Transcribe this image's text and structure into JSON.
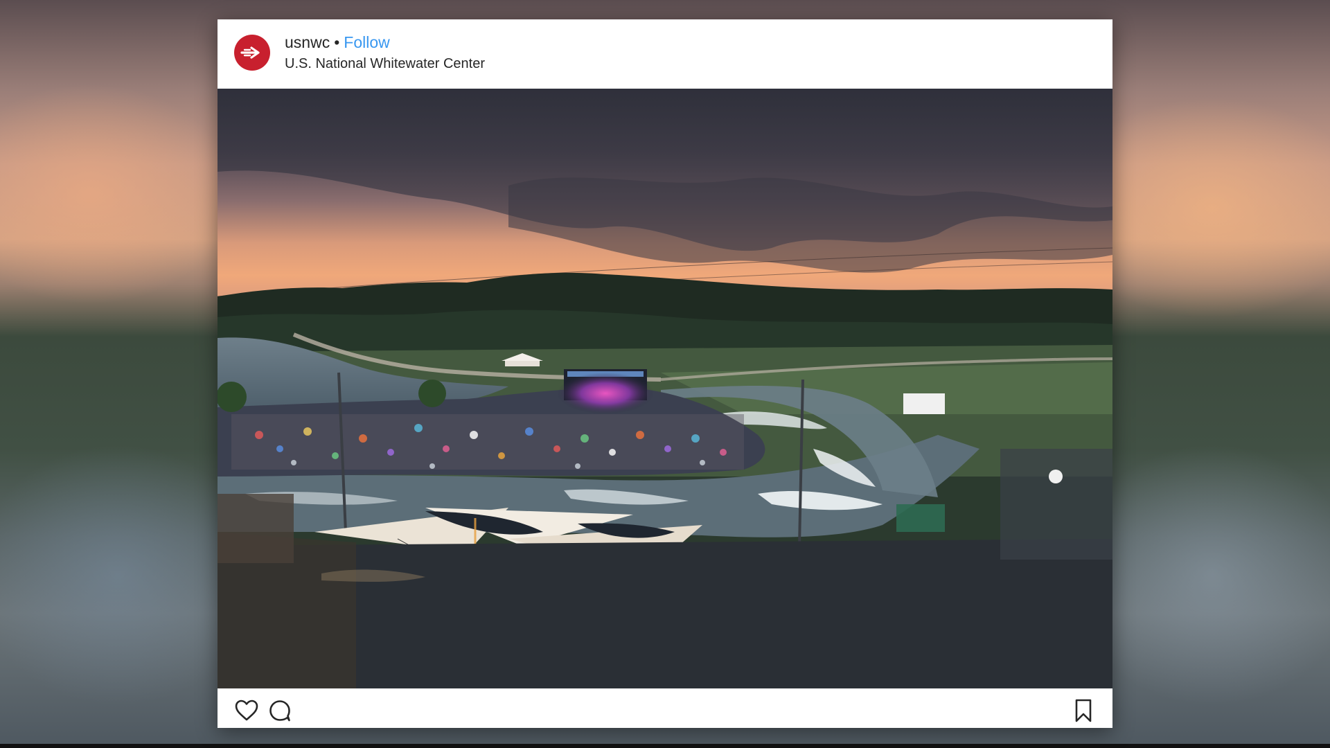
{
  "post": {
    "username": "usnwc",
    "separator": "•",
    "follow_label": "Follow",
    "location": "U.S. National Whitewater Center",
    "avatar_color": "#c8202e",
    "follow_color": "#3897f0"
  },
  "actions": {
    "icons": [
      "heart-icon",
      "comment-icon",
      "bookmark-icon"
    ]
  }
}
